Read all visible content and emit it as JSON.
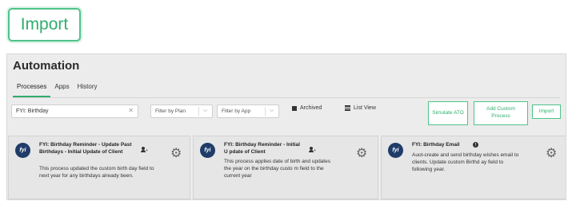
{
  "callout": {
    "label": "Import"
  },
  "app": {
    "title": "Automation",
    "tabs": [
      {
        "label": "Processes",
        "active": true
      },
      {
        "label": "Apps",
        "active": false
      },
      {
        "label": "History",
        "active": false
      }
    ]
  },
  "toolbar": {
    "search": {
      "value": "FYI: Birthday"
    },
    "filter_plan": {
      "placeholder": "Filter by Plan"
    },
    "filter_app": {
      "placeholder": "Filter by App"
    },
    "archived_label": "Archived",
    "list_view_label": "List View",
    "simulate_label": "Simulate ATO",
    "add_custom_label": "Add Custom Process",
    "import_label": "Import"
  },
  "cards": [
    {
      "logo": "fyi",
      "title": "FYI: Birthday Reminder - Update Past Birthdays - Initial Update of Client",
      "description": "This process updated the custom birth day field to next year for any birthdays already been.",
      "icon": "person-icon"
    },
    {
      "logo": "fyi",
      "title": "FYI: Birthday Reminder - Initial U pdate of Client",
      "description": "This process applies date of birth and updates the year on the birthday custo m field to the current year",
      "icon": "person-icon"
    },
    {
      "logo": "fyi",
      "title": "FYI: Birthday Email",
      "description": "Auot-create and send birthday wishes email to clients. Update custom Birthd ay field to following year.",
      "icon": "info-icon"
    }
  ],
  "colors": {
    "accent": "#2fae6c",
    "logo_bg": "#1f3c68",
    "card_bg": "#e6e6e6"
  }
}
